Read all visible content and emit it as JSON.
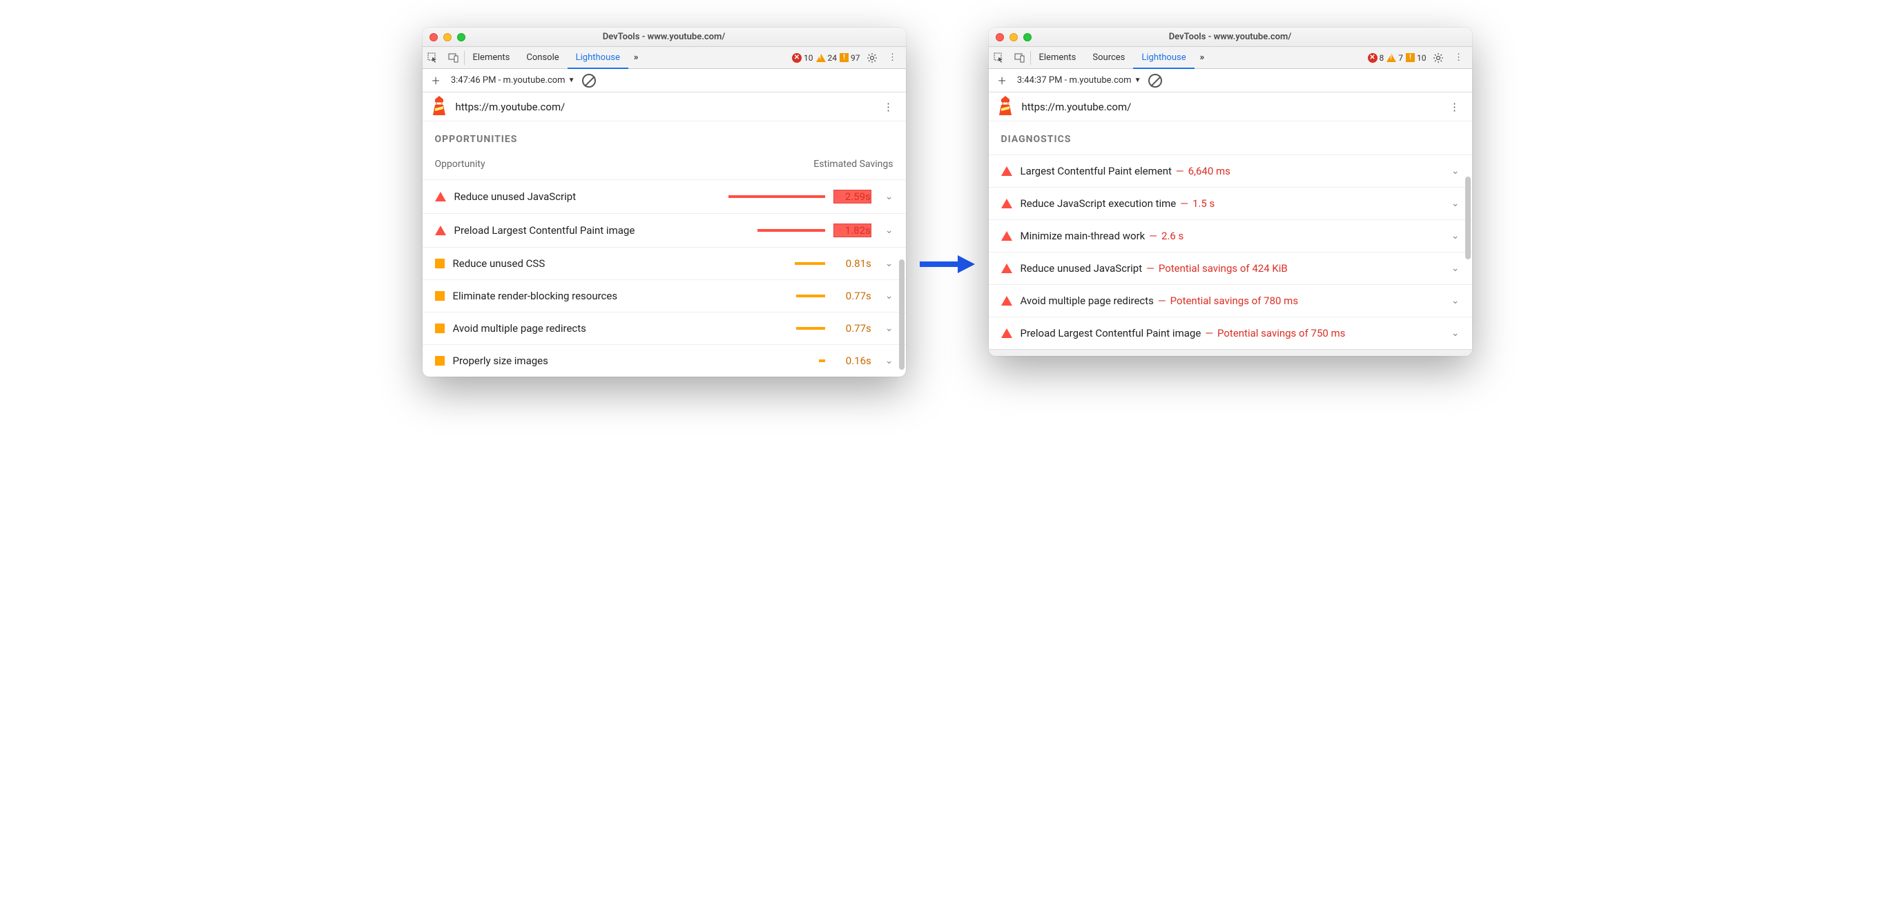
{
  "left": {
    "window_title": "DevTools - www.youtube.com/",
    "tabs": [
      "Elements",
      "Console",
      "Lighthouse"
    ],
    "active_tab": "Lighthouse",
    "errors": 10,
    "warnings": 24,
    "info": 97,
    "report_label": "3:47:46 PM - m.youtube.com",
    "url": "https://m.youtube.com/",
    "section": "Opportunities",
    "col1": "Opportunity",
    "col2": "Estimated Savings",
    "rows": [
      {
        "sev": "tri",
        "title": "Reduce unused JavaScript",
        "barColor": "red",
        "barPct": 100,
        "savings": "2.59s",
        "savColor": "red"
      },
      {
        "sev": "tri",
        "title": "Preload Largest Contentful Paint image",
        "barColor": "red",
        "barPct": 70,
        "savings": "1.82s",
        "savColor": "red"
      },
      {
        "sev": "sq",
        "title": "Reduce unused CSS",
        "barColor": "orange",
        "barPct": 31,
        "savings": "0.81s",
        "savColor": "orange"
      },
      {
        "sev": "sq",
        "title": "Eliminate render-blocking resources",
        "barColor": "orange",
        "barPct": 30,
        "savings": "0.77s",
        "savColor": "orange"
      },
      {
        "sev": "sq",
        "title": "Avoid multiple page redirects",
        "barColor": "orange",
        "barPct": 30,
        "savings": "0.77s",
        "savColor": "orange"
      },
      {
        "sev": "sq",
        "title": "Properly size images",
        "barColor": "orange",
        "barPct": 6,
        "savings": "0.16s",
        "savColor": "orange"
      }
    ]
  },
  "right": {
    "window_title": "DevTools - www.youtube.com/",
    "tabs": [
      "Elements",
      "Sources",
      "Lighthouse"
    ],
    "active_tab": "Lighthouse",
    "errors": 8,
    "warnings": 7,
    "info": 10,
    "report_label": "3:44:37 PM - m.youtube.com",
    "url": "https://m.youtube.com/",
    "section": "Diagnostics",
    "rows": [
      {
        "title": "Largest Contentful Paint element",
        "meta": "6,640 ms"
      },
      {
        "title": "Reduce JavaScript execution time",
        "meta": "1.5 s"
      },
      {
        "title": "Minimize main-thread work",
        "meta": "2.6 s"
      },
      {
        "title": "Reduce unused JavaScript",
        "meta": "Potential savings of 424 KiB"
      },
      {
        "title": "Avoid multiple page redirects",
        "meta": "Potential savings of 780 ms"
      },
      {
        "title": "Preload Largest Contentful Paint image",
        "meta": "Potential savings of 750 ms"
      }
    ]
  }
}
